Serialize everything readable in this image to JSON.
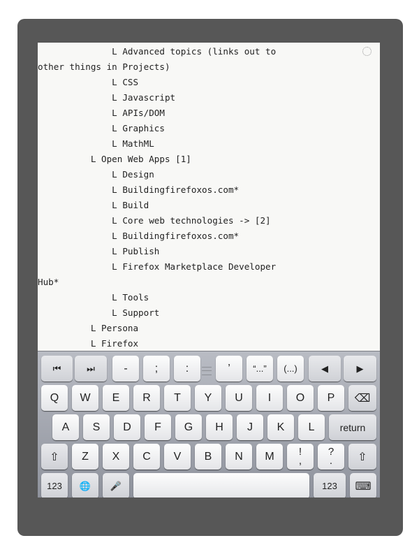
{
  "document": {
    "lines": [
      "              L Advanced topics (links out to",
      "other things in Projects)",
      "              L CSS",
      "              L Javascript",
      "              L APIs/DOM",
      "              L Graphics",
      "              L MathML",
      "          L Open Web Apps [1]",
      "              L Design",
      "              L Buildingfirefoxos.com*",
      "              L Build",
      "              L Core web technologies -> [2]",
      "              L Buildingfirefoxos.com*",
      "              L Publish",
      "              L Firefox Marketplace Developer",
      "Hub*",
      "              L Tools",
      "              L Support",
      "          L Persona",
      "          L Firefox"
    ]
  },
  "keyboard": {
    "extra_row": {
      "cursor_start": "⏮",
      "cursor_end": "⏭",
      "dash": "-",
      "semicolon": ";",
      "colon": ":",
      "apostrophe": "’",
      "quotes": "“...”",
      "parens": "(...)",
      "arrow_left": "◀",
      "arrow_right": "▶"
    },
    "row1": [
      "Q",
      "W",
      "E",
      "R",
      "T",
      "Y",
      "U",
      "I",
      "O",
      "P"
    ],
    "row2": [
      "A",
      "S",
      "D",
      "F",
      "G",
      "H",
      "J",
      "K",
      "L"
    ],
    "row3": [
      "Z",
      "X",
      "C",
      "V",
      "B",
      "N",
      "M"
    ],
    "backspace": "⌫",
    "return_label": "return",
    "shift": "⇧",
    "excl_top": "!",
    "excl_bot": ",",
    "quest_top": "?",
    "quest_bot": ".",
    "numbers_label": "123",
    "globe": "🌐",
    "mic": "🎤",
    "space_label": "",
    "numbers_label_right": "123",
    "hide_keyboard": "⌨"
  },
  "colors": {
    "device_frame": "#575757",
    "paper": "#f8f8f6",
    "keyboard_bg": "#a4a7af",
    "key_face": "#f4f4f5"
  }
}
